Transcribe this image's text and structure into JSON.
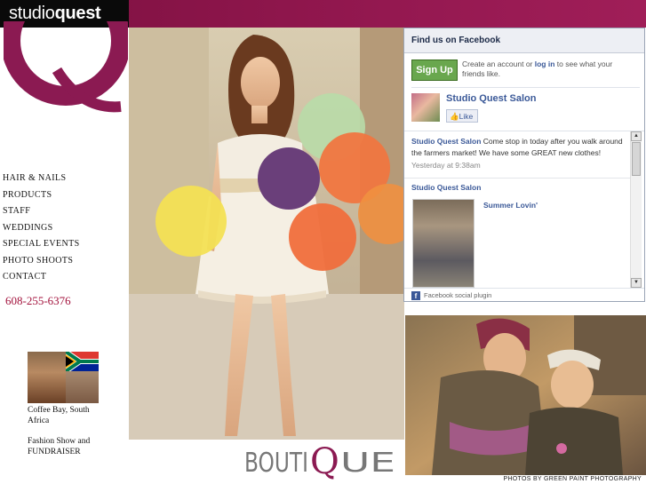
{
  "brand": {
    "light": "studio",
    "bold": "quest"
  },
  "nav": [
    "HAIR & NAILS",
    "PRODUCTS",
    "STAFF",
    "WEDDINGS",
    "SPECIAL EVENTS",
    "PHOTO SHOOTS",
    "CONTACT"
  ],
  "phone": "608-255-6376",
  "sidebar": {
    "caption1": "Coffee Bay, South Africa",
    "caption2": "Fashion Show and FUNDRAISER"
  },
  "boutique": {
    "text_before": "BOUTI",
    "q": "Q",
    "text_after": "UE"
  },
  "photo_credit": "PHOTOS BY GREEN PAINT PHOTOGRAPHY",
  "facebook": {
    "title": "Find us on Facebook",
    "signup_label": "Sign Up",
    "signup_text_1": "Create an account or ",
    "signup_link": "log in",
    "signup_text_2": " to see what your friends like.",
    "page_name": "Studio Quest Salon",
    "like_label": "Like",
    "post1_author": "Studio Quest Salon",
    "post1_text": " Come stop in today after you walk around the farmers market! We have some GREAT new clothes!",
    "post1_time": "Yesterday at 9:38am",
    "post2_author": "Studio Quest Salon",
    "post2_photo_caption": "Summer Lovin'",
    "footer": "Facebook social plugin"
  },
  "colors": {
    "brand": "#941850",
    "accent": "#a3133d",
    "facebook_blue": "#3b5998"
  }
}
